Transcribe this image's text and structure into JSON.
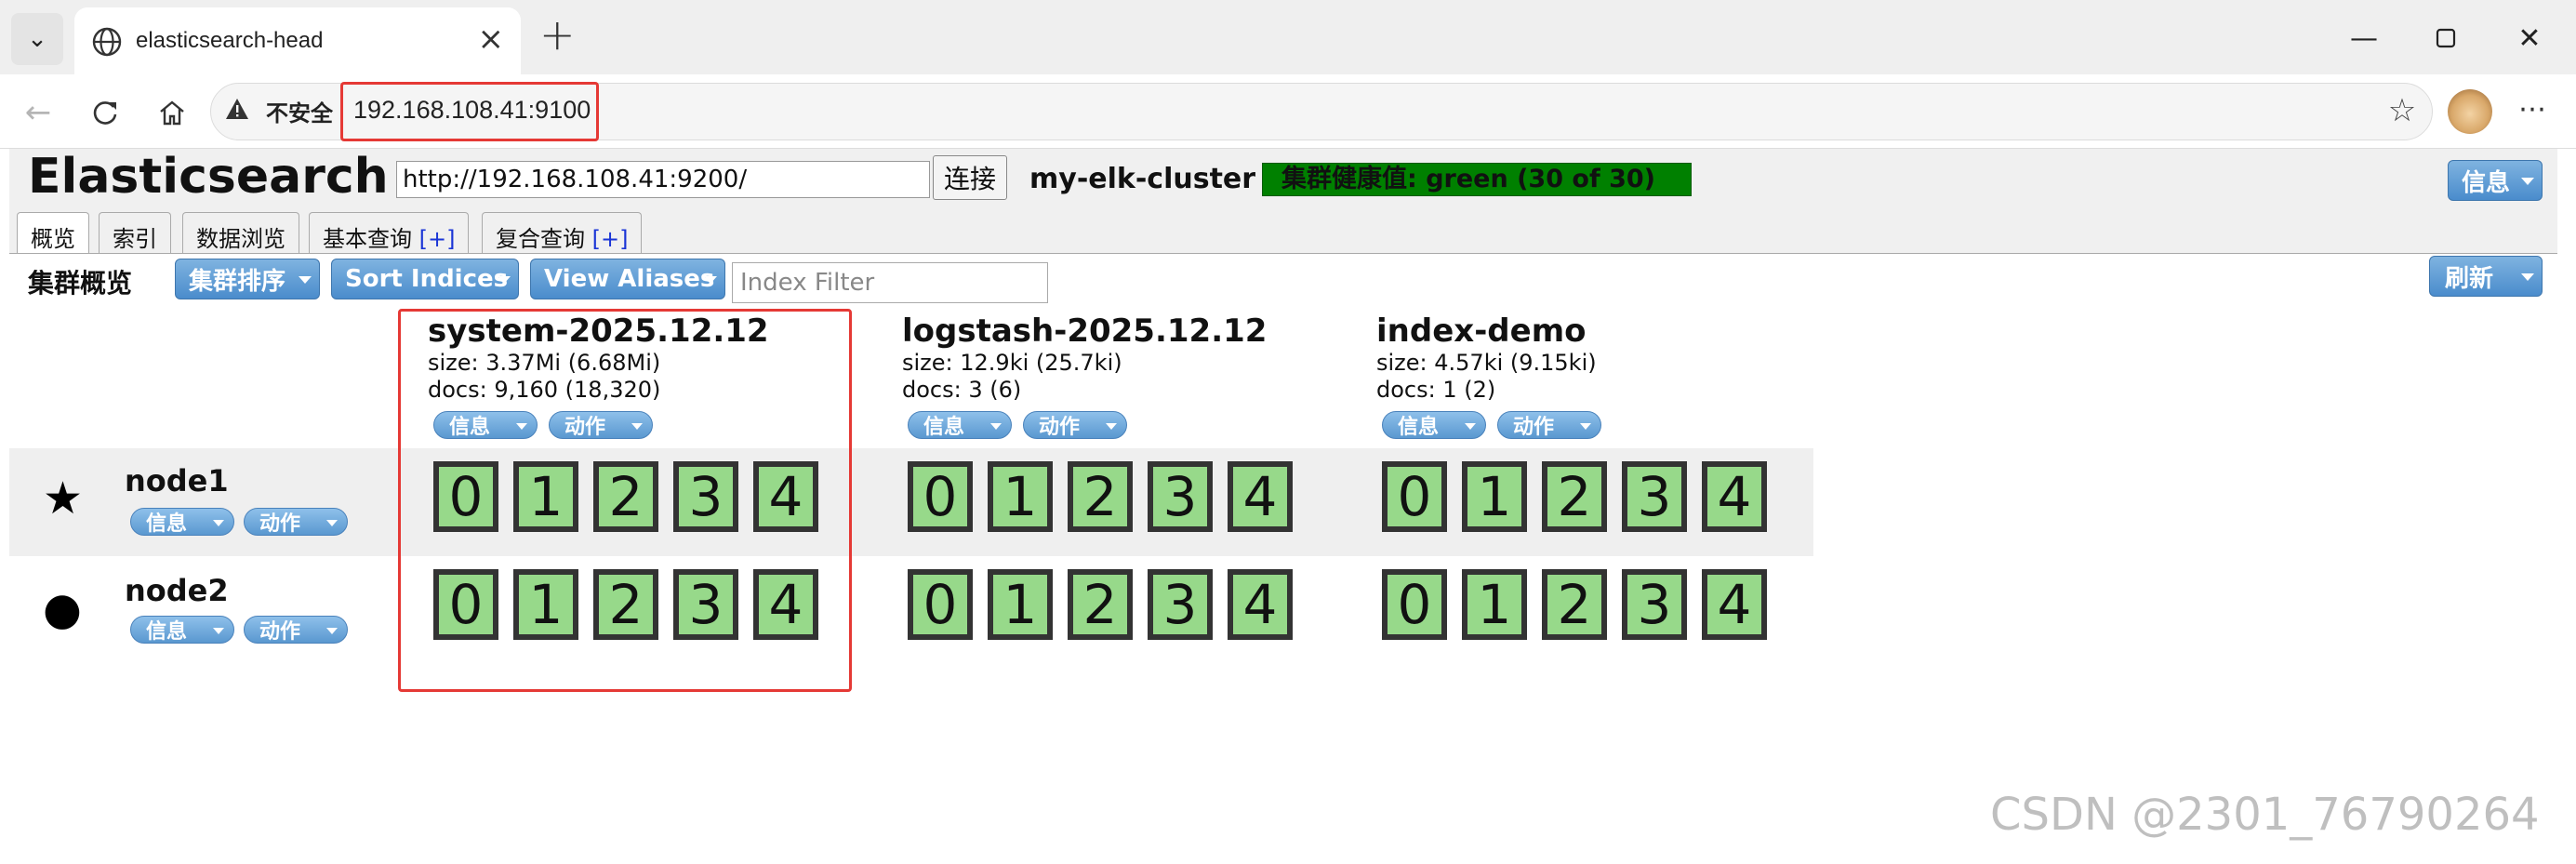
{
  "browser": {
    "tab_title": "elasticsearch-head",
    "security_label": "不安全",
    "url": "192.168.108.41:9100"
  },
  "es": {
    "brand": "Elasticsearch",
    "connect_url": "http://192.168.108.41:9200/",
    "connect_label": "连接",
    "cluster_name": "my-elk-cluster",
    "health": "集群健康值: green (30 of 30)",
    "info_label": "信息",
    "tabs": [
      {
        "label": "概览",
        "plus": ""
      },
      {
        "label": "索引",
        "plus": ""
      },
      {
        "label": "数据浏览",
        "plus": ""
      },
      {
        "label": "基本查询",
        "plus": "[+]"
      },
      {
        "label": "复合查询",
        "plus": "[+]"
      }
    ],
    "toolbar": {
      "title": "集群概览",
      "sort_cluster": "集群排序",
      "sort_indices": "Sort Indices",
      "view_aliases": "View Aliases",
      "filter_placeholder": "Index Filter",
      "refresh": "刷新"
    },
    "pill_info": "信息",
    "pill_action": "动作",
    "indices": [
      {
        "name": "system-2025.12.12",
        "size": "size: 3.37Mi (6.68Mi)",
        "docs": "docs: 9,160 (18,320)"
      },
      {
        "name": "logstash-2025.12.12",
        "size": "size: 12.9ki (25.7ki)",
        "docs": "docs: 3 (6)"
      },
      {
        "name": "index-demo",
        "size": "size: 4.57ki (9.15ki)",
        "docs": "docs: 1 (2)"
      }
    ],
    "nodes": [
      {
        "name": "node1",
        "icon": "star-icon",
        "glyph": "★"
      },
      {
        "name": "node2",
        "icon": "circle-icon",
        "glyph": "●"
      }
    ],
    "shards": [
      "0",
      "1",
      "2",
      "3",
      "4"
    ],
    "shard_color": "#97d98a",
    "health_color": "#008000"
  },
  "watermark": "CSDN @2301_76790264"
}
